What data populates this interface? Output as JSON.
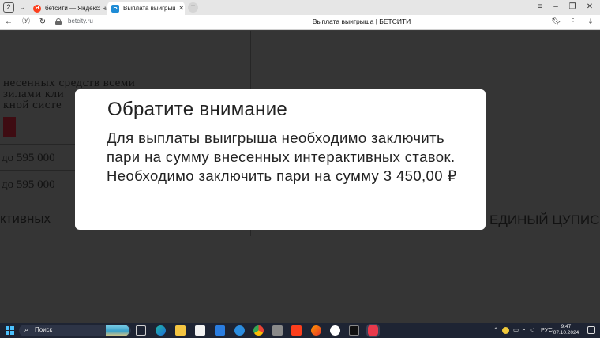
{
  "browser": {
    "tab_counter": "2",
    "tabs": [
      {
        "title": "бетсити — Яндекс: нашлось",
        "active": false
      },
      {
        "title": "Выплата выигрыша | БЕТСИТИ",
        "active": true
      }
    ],
    "url": "betcity.ru",
    "page_title": "Выплата выигрыша | БЕТСИТИ"
  },
  "background": {
    "line1": "несенных средств всеми",
    "line2": "зилами кли",
    "line3": "кной систе",
    "amount1": "до 595 000",
    "amount2": "до 595 000",
    "section_left": "ктивных",
    "section_right": "ЕДИНЫЙ ЦУПИС"
  },
  "modal": {
    "title": "Обратите внимание",
    "body": "Для выплаты выигрыша необходимо заключить пари на сумму внесенных интерактивных ставок. Необходимо заключить пари на сумму 3 450,00 ₽"
  },
  "taskbar": {
    "search_label": "Поиск",
    "language": "РУС",
    "time": "9:47",
    "date": "07.10.2024"
  },
  "colors": {
    "overlay_bg": "#353535",
    "modal_bg": "#ffffff",
    "taskbar_bg": "#1e2433",
    "yandex_red": "#fc3f1d"
  }
}
